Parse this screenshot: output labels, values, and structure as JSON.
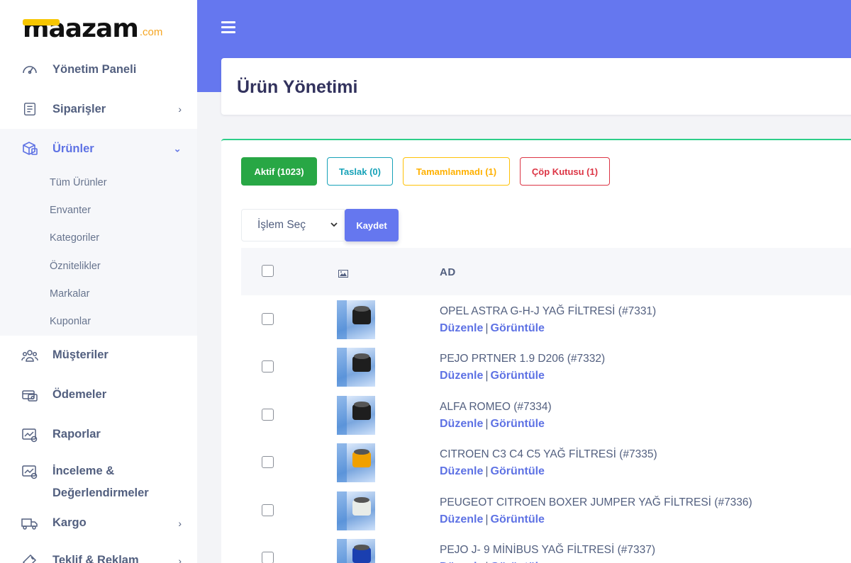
{
  "logo": {
    "brand": "maazam",
    "suffix": ".com"
  },
  "sidebar": {
    "items": [
      {
        "label": "Yönetim Paneli",
        "icon": "speedometer-icon"
      },
      {
        "label": "Siparişler",
        "icon": "order-list-icon",
        "chevron": "›"
      },
      {
        "label": "Ürünler",
        "icon": "products-box-icon",
        "chevron": "⌄"
      },
      {
        "label": "Müşteriler",
        "icon": "customers-icon"
      },
      {
        "label": "Ödemeler",
        "icon": "payments-icon"
      },
      {
        "label": "Raporlar",
        "icon": "reports-icon"
      },
      {
        "label": "İnceleme & Değerlendirmeler",
        "icon": "reviews-icon"
      },
      {
        "label": "Kargo",
        "icon": "shipping-truck-icon",
        "chevron": "›"
      },
      {
        "label": "Teklif & Reklam",
        "icon": "megaphone-icon",
        "chevron": "›"
      }
    ],
    "submenu": [
      "Tüm Ürünler",
      "Envanter",
      "Kategoriler",
      "Öznitelikler",
      "Markalar",
      "Kuponlar"
    ]
  },
  "page": {
    "title": "Ürün Yönetimi"
  },
  "filters": [
    {
      "label": "Aktif (1023)"
    },
    {
      "label": "Taslak (0)"
    },
    {
      "label": "Tamamlanmadı (1)"
    },
    {
      "label": "Çöp Kutusu (1)"
    }
  ],
  "actions": {
    "select_value": "İşlem Seç",
    "save_label": "Kaydet"
  },
  "table": {
    "headers": {
      "image_icon": "image-icon",
      "name": "AD"
    },
    "edit_label": "Düzenle",
    "view_label": "Görüntüle",
    "separator": "|",
    "rows": [
      {
        "name": "OPEL ASTRA G-H-J YAĞ FİLTRESİ (#7331)"
      },
      {
        "name": "PEJO PRTNER 1.9 D206 (#7332)"
      },
      {
        "name": "ALFA ROMEO (#7334)"
      },
      {
        "name": "CITROEN C3 C4 C5 YAĞ FİLTRESİ (#7335)"
      },
      {
        "name": "PEUGEOT CITROEN BOXER JUMPER YAĞ FİLTRESİ (#7336)"
      },
      {
        "name": "PEJO J- 9 MİNİBUS YAĞ FİLTRESİ (#7337)"
      }
    ]
  },
  "colors": {
    "primary": "#6577ef",
    "success": "#28a745",
    "info": "#17a2b8",
    "warning": "#ffc107",
    "danger": "#dc3545"
  }
}
